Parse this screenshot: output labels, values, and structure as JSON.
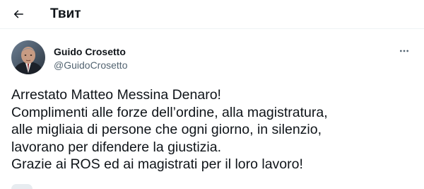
{
  "header": {
    "title": "Твит",
    "back_icon": "arrow-left-icon"
  },
  "tweet": {
    "author": {
      "name": "Guido Crosetto",
      "handle": "@GuidoCrosetto",
      "avatar_icon": "avatar-photo"
    },
    "more_icon": "ellipsis-icon",
    "text_lines": [
      "Arrestato Matteo Messina Denaro!",
      "Complimenti alle forze dell’ordine, alla magistratura,",
      "alle migliaia di persone che ogni giorno, in silenzio,",
      "lavorano per difendere la giustizia.",
      "Grazie ai ROS ed ai magistrati per il loro lavoro!"
    ]
  },
  "colors": {
    "text_primary": "#0f1419",
    "text_secondary": "#536471",
    "border": "#eff3f4"
  }
}
